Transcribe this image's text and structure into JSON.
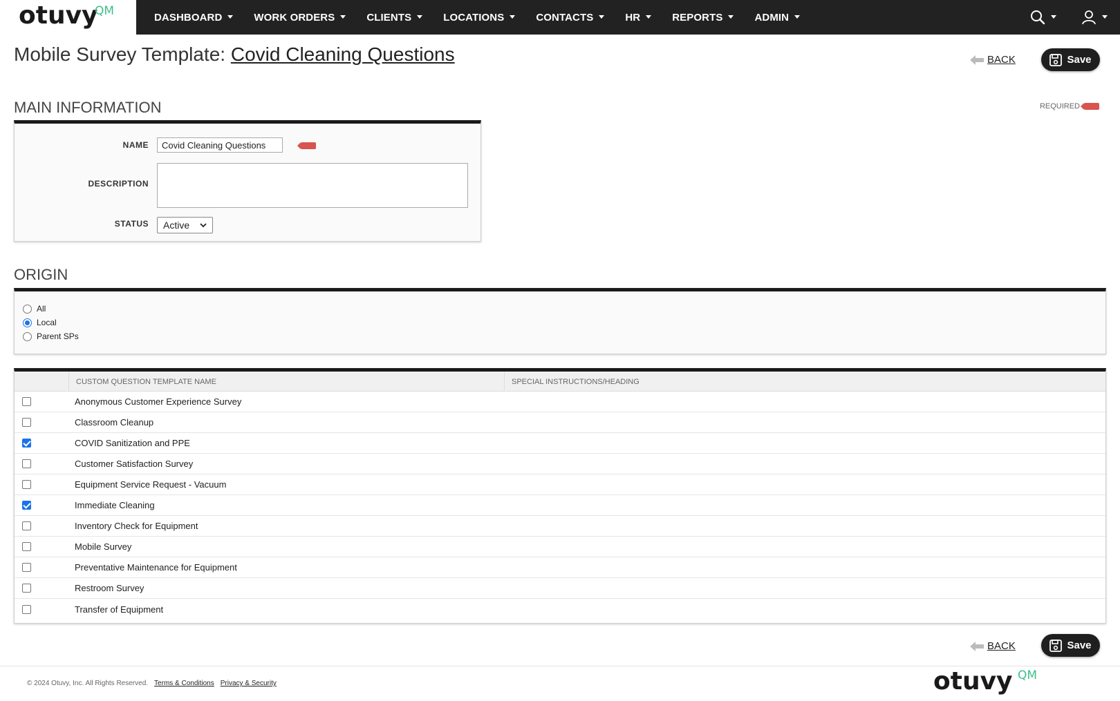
{
  "brand": {
    "logo_text": "otuvy",
    "logo_suffix": "QM"
  },
  "nav": {
    "items": [
      {
        "label": "DASHBOARD"
      },
      {
        "label": "WORK ORDERS"
      },
      {
        "label": "CLIENTS"
      },
      {
        "label": "LOCATIONS"
      },
      {
        "label": "CONTACTS"
      },
      {
        "label": "HR"
      },
      {
        "label": "REPORTS"
      },
      {
        "label": "ADMIN"
      }
    ],
    "search_icon": "search-icon",
    "user_icon": "user-icon"
  },
  "header": {
    "title_prefix": "Mobile Survey Template:",
    "title_name": "Covid Cleaning Questions",
    "back_label": "BACK",
    "save_label": "Save"
  },
  "main_info": {
    "heading": "MAIN INFORMATION",
    "required_label": "REQUIRED",
    "name_label": "NAME",
    "name_value": "Covid Cleaning Questions",
    "description_label": "DESCRIPTION",
    "description_value": "",
    "status_label": "STATUS",
    "status_value": "Active"
  },
  "origin": {
    "heading": "ORIGIN",
    "options": [
      {
        "label": "All",
        "checked": false
      },
      {
        "label": "Local",
        "checked": true
      },
      {
        "label": "Parent SPs",
        "checked": false
      }
    ]
  },
  "questions_table": {
    "columns": [
      "CUSTOM QUESTION TEMPLATE NAME",
      "SPECIAL INSTRUCTIONS/HEADING"
    ],
    "rows": [
      {
        "name": "Anonymous Customer Experience Survey",
        "checked": false
      },
      {
        "name": "Classroom Cleanup",
        "checked": false
      },
      {
        "name": "COVID Sanitization and PPE",
        "checked": true
      },
      {
        "name": "Customer Satisfaction Survey",
        "checked": false
      },
      {
        "name": "Equipment Service Request - Vacuum",
        "checked": false
      },
      {
        "name": "Immediate Cleaning",
        "checked": true
      },
      {
        "name": "Inventory Check for Equipment",
        "checked": false
      },
      {
        "name": "Mobile Survey",
        "checked": false
      },
      {
        "name": "Preventative Maintenance for Equipment",
        "checked": false
      },
      {
        "name": "Restroom Survey",
        "checked": false
      },
      {
        "name": "Transfer of Equipment",
        "checked": false
      }
    ]
  },
  "footer": {
    "copyright": "© 2024 Otuvy, Inc. All Rights Reserved.",
    "terms_label": "Terms & Conditions",
    "privacy_label": "Privacy & Security"
  },
  "colors": {
    "nav_bg": "#222222",
    "accent": "#3fbf8a",
    "required": "#d9534f",
    "checkbox": "#1a73e8"
  }
}
